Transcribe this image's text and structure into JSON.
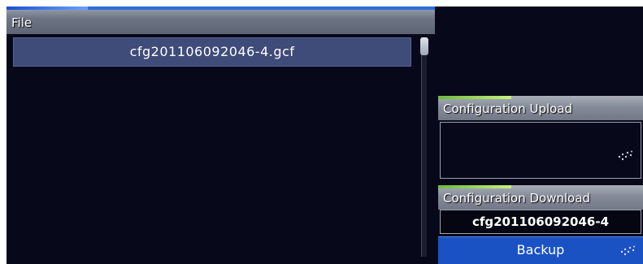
{
  "file_panel": {
    "title": "File",
    "files": [
      {
        "name": "cfg201106092046-4.gcf",
        "selected": true
      }
    ]
  },
  "config_upload": {
    "title": "Configuration Upload"
  },
  "config_download": {
    "title": "Configuration Download",
    "filename": "cfg201106092046-4",
    "backup_label": "Backup"
  },
  "icons": {
    "upload_indicator": "sparkle-cursor-icon",
    "backup_indicator": "sparkle-cursor-icon"
  },
  "colors": {
    "background": "#07081a",
    "selected_row": "#3f4b78",
    "button_blue": "#1a52c4",
    "header_accent_green": "#9ee05a",
    "header_accent_blue": "#2a6fd8"
  }
}
